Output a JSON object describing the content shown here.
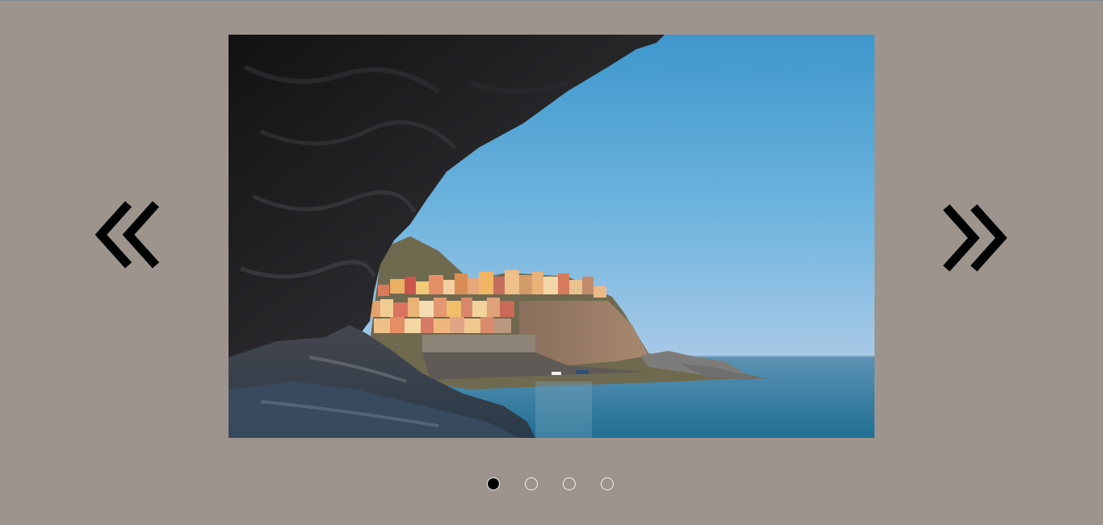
{
  "colors": {
    "page_background": "#9d948e",
    "arrow_color": "#000000",
    "dot_active_fill": "#000000",
    "dot_border": "#f4f1ee"
  },
  "carousel": {
    "prev_icon": "double-chevron-left-icon",
    "next_icon": "double-chevron-right-icon",
    "current_slide_index": 0,
    "slide_count": 4,
    "slide_image": "sea-cave-view-of-cliffside-village"
  }
}
